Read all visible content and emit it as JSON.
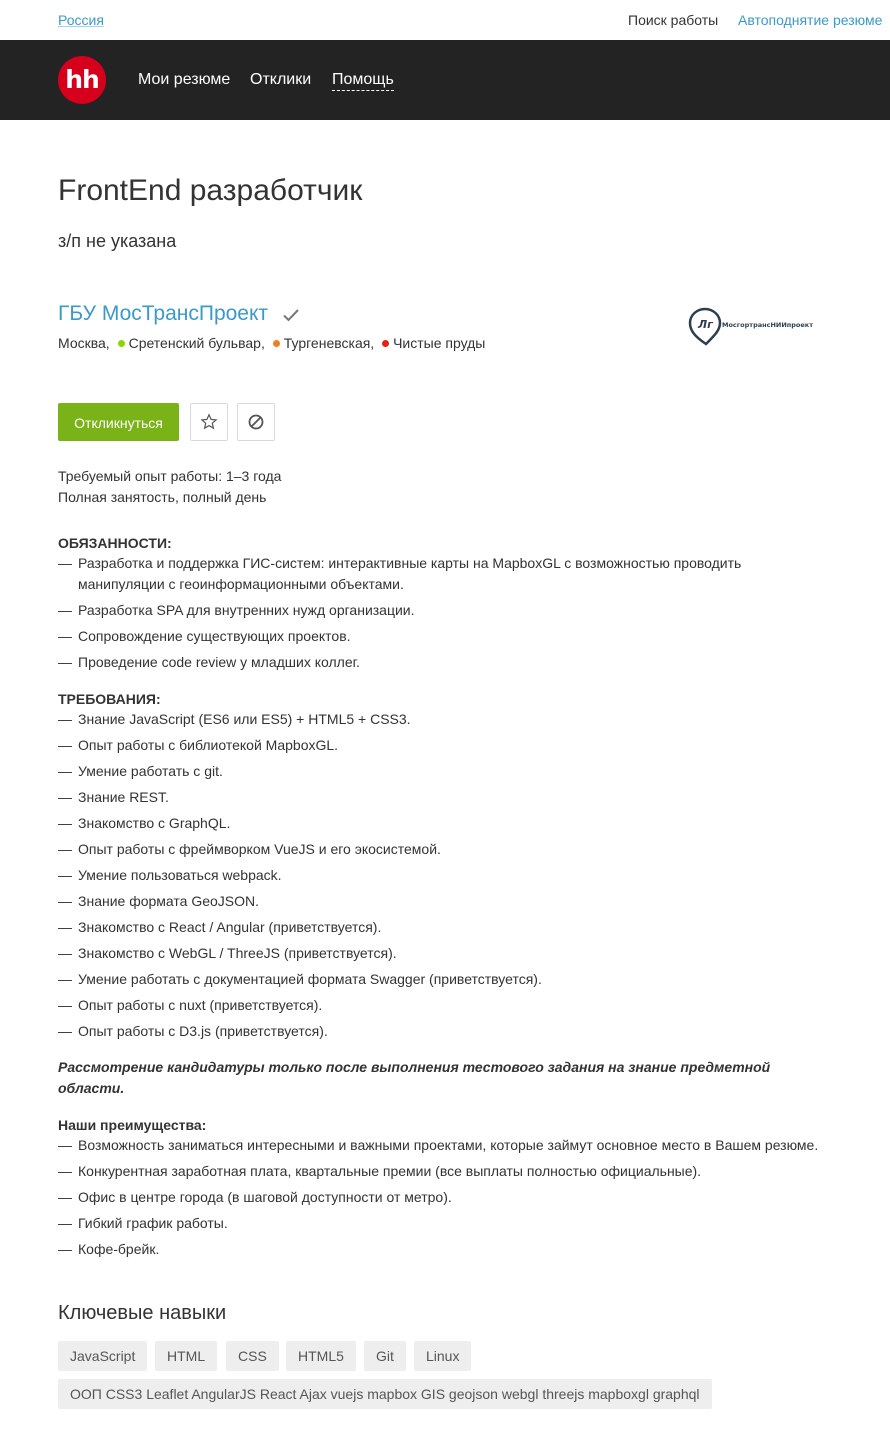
{
  "topbar": {
    "region": "Россия",
    "job_search": "Поиск работы",
    "autoraise": "Автоподнятие резюме"
  },
  "nav": {
    "logo_text": "hh",
    "my_resumes": "Мои резюме",
    "responses": "Отклики",
    "help": "Помощь"
  },
  "vacancy": {
    "title": "FrontEnd разработчик",
    "salary": "з/п не указана",
    "company": "ГБУ МосТрансПроект",
    "company_logo_text": "МосгортрансНИИпроект",
    "city": "Москва,",
    "metro": [
      {
        "name": "Сретенский бульвар,",
        "color": "#8fd400"
      },
      {
        "name": "Тургеневская,",
        "color": "#f07e24"
      },
      {
        "name": "Чистые пруды",
        "color": "#e42313"
      }
    ],
    "experience": "Требуемый опыт работы: 1–3 года",
    "employment": "Полная занятость, полный день"
  },
  "actions": {
    "respond": "Откликнуться",
    "favorite_icon": "star-icon",
    "hide_icon": "block-icon"
  },
  "description": {
    "duties_title": "ОБЯЗАННОСТИ:",
    "duties": [
      "Разработка и поддержка ГИС-систем: интерактивные карты на MapboxGL с возможностью проводить манипуляции с геоинформационными объектами.",
      "Разработка SPA для внутренних нужд организации.",
      "Сопровождение существующих проектов.",
      "Проведение code review у младших коллег."
    ],
    "requirements_title": "ТРЕБОВАНИЯ:",
    "requirements": [
      "Знание JavaScript (ES6 или ES5) + HTML5 + CSS3.",
      "Опыт работы с библиотекой MapboxGL.",
      "Умение работать с git.",
      "Знание REST.",
      "Знакомство с GraphQL.",
      "Опыт работы с фреймворком VueJS и его экосистемой.",
      "Умение пользоваться webpack.",
      "Знание формата GeoJSON.",
      "Знакомство с React / Angular (приветствуется).",
      "Знакомство с WebGL / ThreeJS (приветствуется).",
      "Умение работать с документацией формата Swagger (приветствуется).",
      "Опыт работы с nuxt (приветствуется).",
      "Опыт работы с D3.js (приветствуется)."
    ],
    "note": "Рассмотрение кандидатуры только после выполнения тестового задания на знание предметной области.",
    "benefits_title": "Наши преимущества:",
    "benefits": [
      "Возможность заниматься интересными и важными проектами, которые займут основное место в Вашем резюме.",
      "Конкурентная заработная плата, квартальные премии (все выплаты полностью официальные).",
      "Офис в центре города (в шаговой доступности от метро).",
      "Гибкий график работы.",
      "Кофе-брейк."
    ]
  },
  "skills": {
    "title": "Ключевые навыки",
    "tags": [
      "JavaScript",
      "HTML",
      "CSS",
      "HTML5",
      "Git",
      "Linux",
      "ООП CSS3 Leaflet AngularJS React Ajax vuejs mapbox GIS geojson webgl threejs mapboxgl graphql"
    ]
  },
  "colors": {
    "link": "#3a9ac9",
    "nav_bg": "#232323",
    "logo_red": "#d6001c",
    "respond_green": "#7ab317"
  }
}
